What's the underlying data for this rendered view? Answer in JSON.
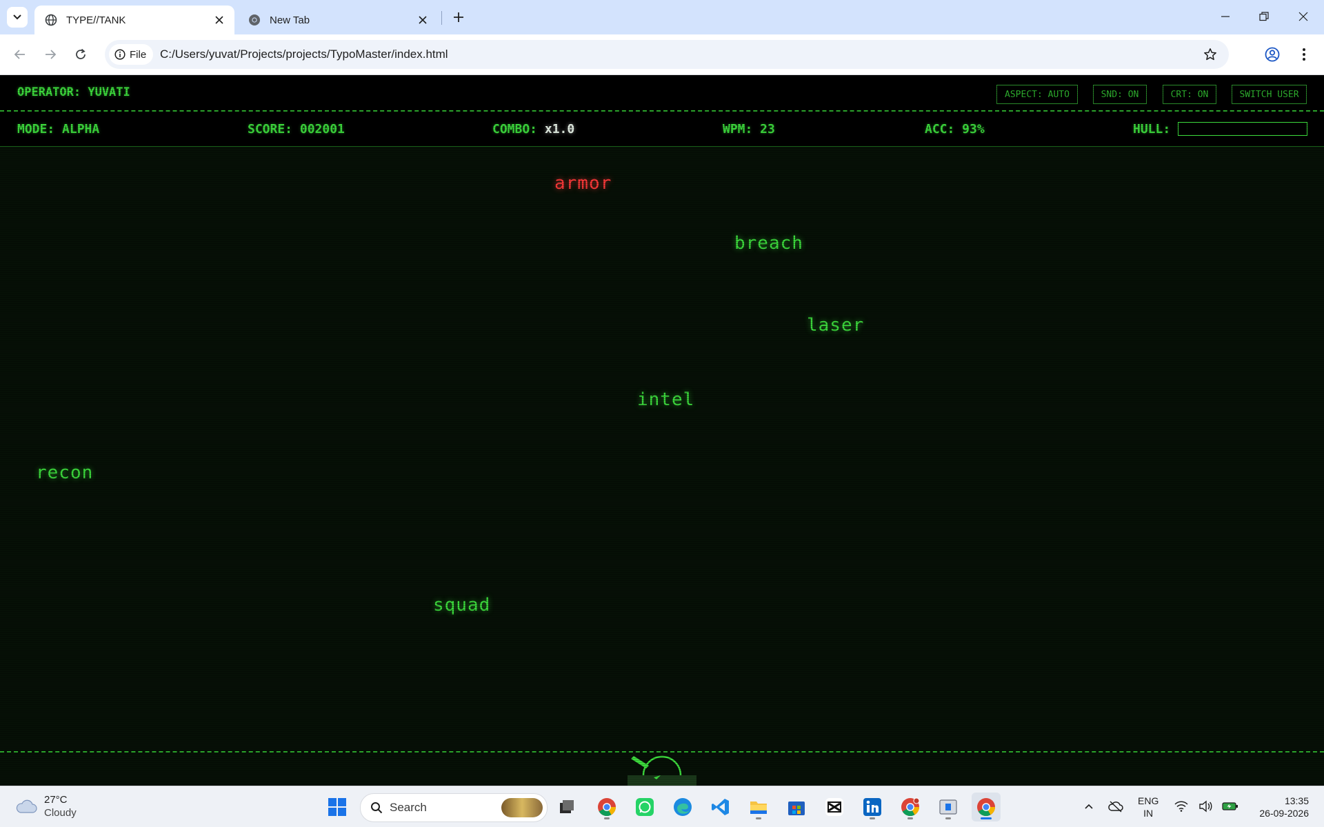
{
  "browser": {
    "tabs": [
      {
        "title": "TYPE//TANK",
        "active": true
      },
      {
        "title": "New Tab",
        "active": false
      }
    ],
    "address": {
      "chip": "File",
      "url": "C:/Users/yuvat/Projects/projects/TypoMaster/index.html"
    }
  },
  "game": {
    "operator": "OPERATOR: YUVATI",
    "buttons": {
      "aspect": "ASPECT: AUTO",
      "sound": "SND: ON",
      "crt": "CRT: ON",
      "switch_user": "SWITCH USER"
    },
    "stats": {
      "mode_label": "MODE: ALPHA",
      "score_label": "SCORE: 002001",
      "combo_label": "COMBO:",
      "combo_value": "x1.0",
      "wpm_label": "WPM: 23",
      "acc_label": "ACC: 93%",
      "hull_label": "HULL:",
      "hull_fraction": 0
    },
    "words": [
      {
        "text": "armor",
        "state": "danger"
      },
      {
        "text": "breach",
        "state": "normal"
      },
      {
        "text": "laser",
        "state": "normal"
      },
      {
        "text": "intel",
        "state": "normal"
      },
      {
        "text": "recon",
        "state": "normal"
      },
      {
        "text": "squad",
        "state": "normal"
      }
    ],
    "colors": {
      "primary": "#3ddc3d",
      "danger": "#ff3a3a",
      "background": "#061006"
    }
  },
  "taskbar": {
    "weather": {
      "temp": "27°C",
      "condition": "Cloudy"
    },
    "search_label": "Search",
    "language": {
      "line1": "ENG",
      "line2": "IN"
    },
    "clock": {
      "time": "13:35",
      "date": "26-09-2026"
    }
  }
}
